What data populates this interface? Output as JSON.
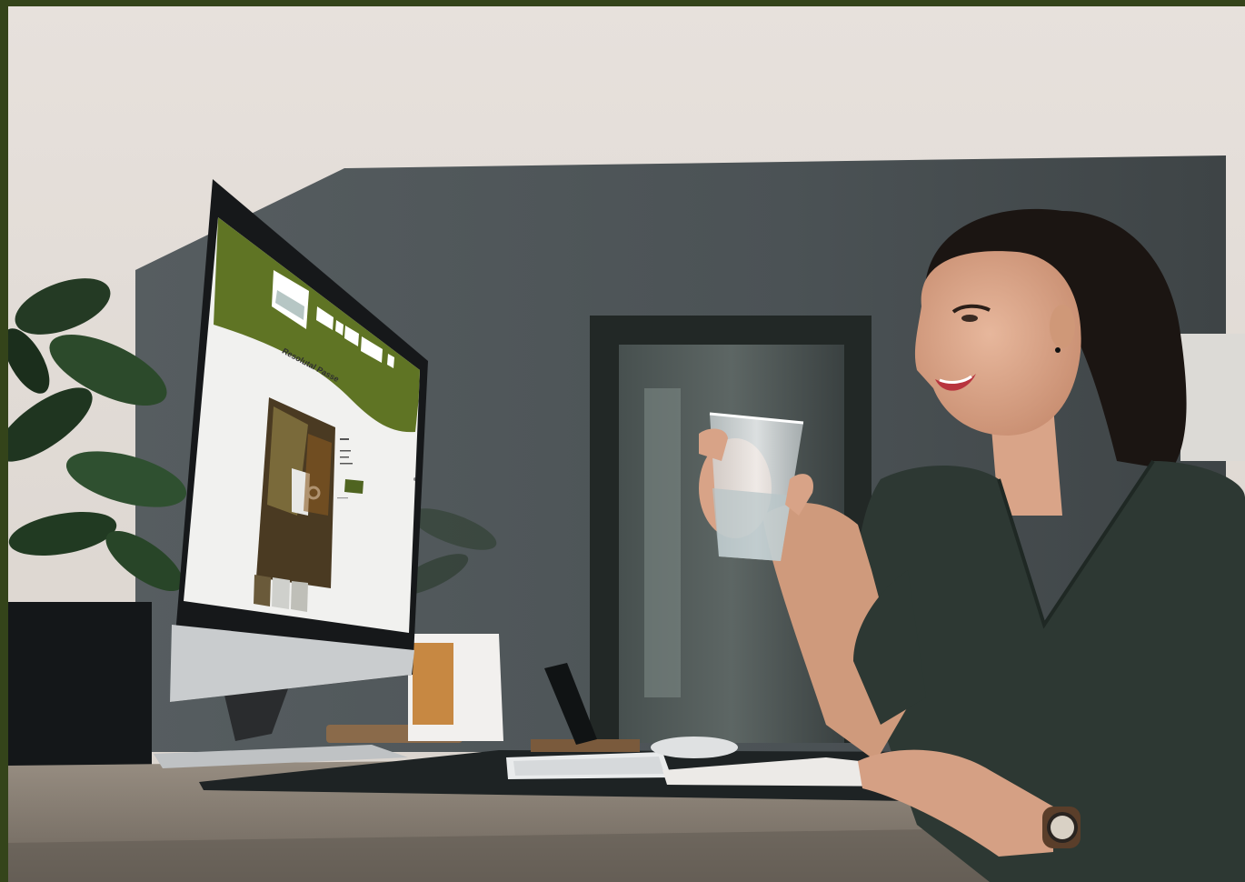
{
  "colors": {
    "frame": "#34441a",
    "site_green": "#5f7424",
    "wall": "#e9e4df",
    "panel": "#4a5052",
    "desk": "#8d8478",
    "shirt": "#2d3833"
  },
  "monitor": {
    "nav": [
      "",
      "",
      "",
      "",
      ""
    ],
    "page_title": "Resolutal Passe",
    "product_title": "",
    "cart_button": ""
  }
}
